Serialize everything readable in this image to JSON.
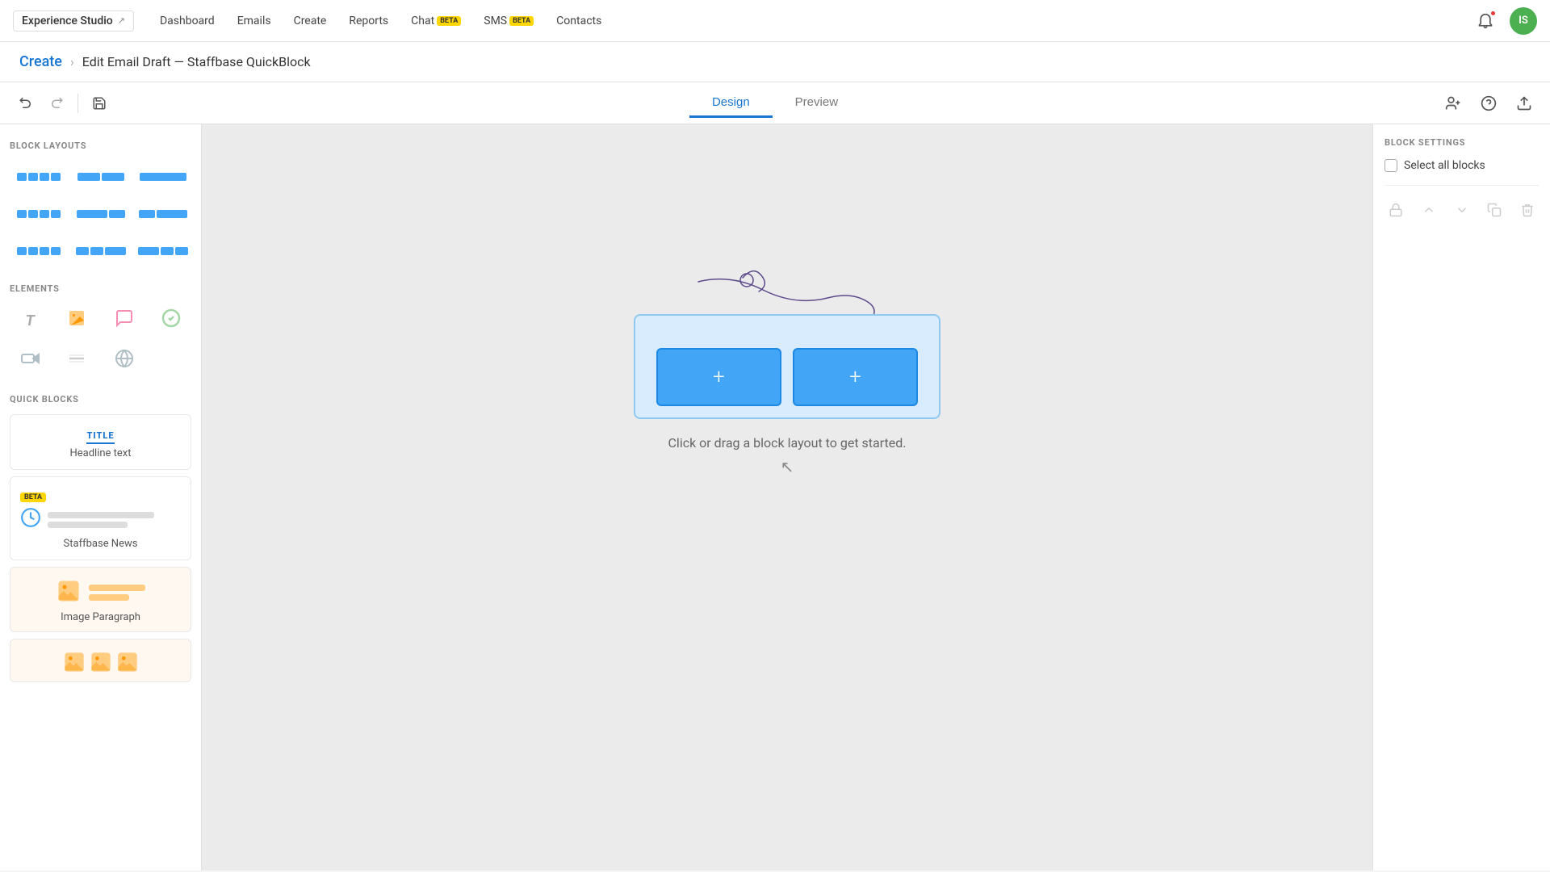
{
  "app": {
    "logo_label": "Experience Studio",
    "logo_ext_icon": "↗"
  },
  "nav": {
    "links": [
      {
        "label": "Dashboard",
        "beta": false
      },
      {
        "label": "Emails",
        "beta": false
      },
      {
        "label": "Create",
        "beta": false
      },
      {
        "label": "Reports",
        "beta": false
      },
      {
        "label": "Chat",
        "beta": true
      },
      {
        "label": "SMS",
        "beta": true
      },
      {
        "label": "Contacts",
        "beta": false
      }
    ]
  },
  "breadcrumb": {
    "create_label": "Create",
    "separator": "▶",
    "current_label": "Edit Email Draft — Staffbase QuickBlock"
  },
  "toolbar": {
    "undo_label": "↺",
    "redo_label": "↻",
    "save_label": "💾",
    "tabs": [
      {
        "id": "design",
        "label": "Design",
        "active": true
      },
      {
        "id": "preview",
        "label": "Preview",
        "active": false
      }
    ],
    "add_user_icon": "👤+",
    "help_icon": "?",
    "export_icon": "↗"
  },
  "left_panel": {
    "block_layouts_title": "BLOCK LAYOUTS",
    "elements_title": "ELEMENTS",
    "quick_blocks_title": "QUICK BLOCKS",
    "layouts": [
      {
        "cols": [
          1,
          1,
          1,
          1
        ]
      },
      {
        "cols": [
          2,
          2
        ]
      },
      {
        "cols": [
          3
        ]
      },
      {
        "cols": [
          1,
          1,
          1,
          1
        ]
      },
      {
        "cols": [
          2,
          1
        ]
      },
      {
        "cols": [
          1,
          2
        ]
      },
      {
        "cols": [
          1,
          1,
          1,
          1
        ]
      },
      {
        "cols": [
          1,
          1,
          2
        ]
      },
      {
        "cols": [
          2,
          1,
          1
        ]
      }
    ],
    "elements": [
      {
        "icon": "T",
        "type": "text"
      },
      {
        "icon": "🖼",
        "type": "image"
      },
      {
        "icon": "💬",
        "type": "chat"
      },
      {
        "icon": "✓",
        "type": "check"
      },
      {
        "icon": "▶",
        "type": "video"
      },
      {
        "icon": "—",
        "type": "divider"
      },
      {
        "icon": "🌐",
        "type": "globe"
      }
    ],
    "quick_blocks": [
      {
        "id": "title-headline",
        "title_label": "TITLE",
        "subtext": "Headline text",
        "type": "title",
        "bg": "#ffffff"
      },
      {
        "id": "staffbase-news",
        "beta": true,
        "name": "Staffbase News",
        "type": "news",
        "bg": "#ffffff"
      },
      {
        "id": "image-paragraph",
        "name": "Image Paragraph",
        "type": "image-para",
        "bg": "#fff8f0"
      },
      {
        "id": "gallery",
        "name": "Gallery",
        "type": "gallery",
        "bg": "#fff8f0"
      }
    ]
  },
  "canvas": {
    "hint_text": "Click or drag a block layout to get started."
  },
  "right_panel": {
    "title": "BLOCK SETTINGS",
    "select_all_label": "Select all blocks",
    "actions": [
      {
        "icon": "🔒",
        "name": "lock"
      },
      {
        "icon": "↑",
        "name": "move-up"
      },
      {
        "icon": "↓",
        "name": "move-down"
      },
      {
        "icon": "⧉",
        "name": "duplicate"
      },
      {
        "icon": "🗑",
        "name": "delete"
      }
    ]
  },
  "avatar": {
    "initials": "IS",
    "bg_color": "#4caf50"
  }
}
